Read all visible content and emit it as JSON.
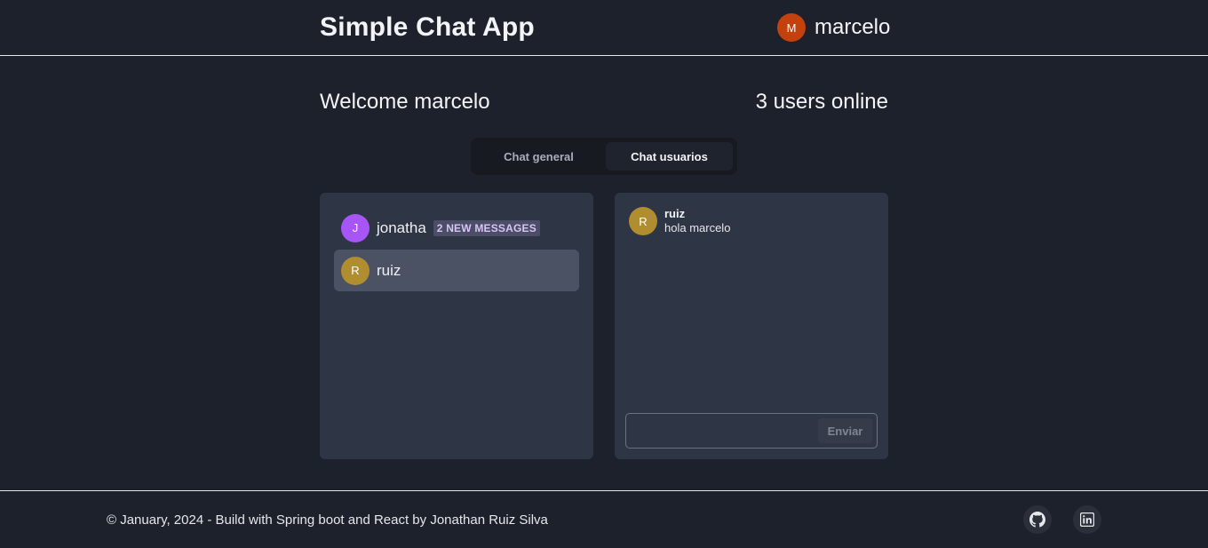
{
  "header": {
    "title": "Simple Chat App",
    "user": {
      "initial": "M",
      "name": "marcelo",
      "avatar_color": "#c2410c"
    }
  },
  "welcome": {
    "text": "Welcome marcelo",
    "online_text": "3 users online"
  },
  "tabs": [
    {
      "label": "Chat general",
      "active": false
    },
    {
      "label": "Chat usuarios",
      "active": true
    }
  ],
  "users": [
    {
      "initial": "J",
      "name": "jonatha",
      "avatar_color": "#a855f7",
      "badge": "2 NEW MESSAGES",
      "selected": false
    },
    {
      "initial": "R",
      "name": "ruiz",
      "avatar_color": "#b08d2e",
      "badge": "",
      "selected": true
    }
  ],
  "chat": {
    "messages": [
      {
        "initial": "R",
        "author": "ruiz",
        "text": "hola marcelo",
        "avatar_color": "#b08d2e"
      }
    ],
    "input": {
      "value": "",
      "placeholder": ""
    },
    "send_label": "Enviar"
  },
  "footer": {
    "text": "© January, 2024 - Build with Spring boot and React by Jonathan Ruiz Silva",
    "links": [
      {
        "icon": "github-icon"
      },
      {
        "icon": "linkedin-icon"
      }
    ]
  }
}
